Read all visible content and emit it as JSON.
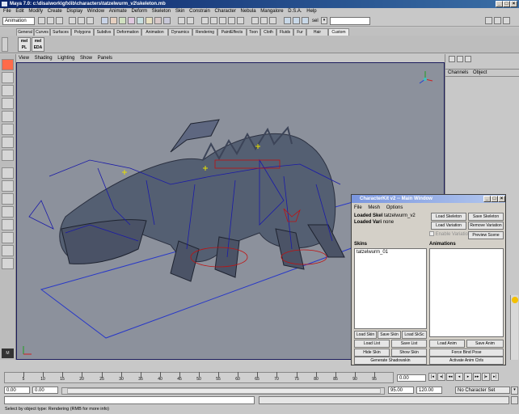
{
  "title": "Maya 7.0: c:\\disa\\work\\gfxlib\\characters\\tatzelwurm_v2\\skeleton.mb",
  "menus": [
    "File",
    "Edit",
    "Modify",
    "Create",
    "Display",
    "Window",
    "Animate",
    "Deform",
    "Skeleton",
    "Skin",
    "Constrain",
    "Character",
    "Nebula",
    "Mangalore",
    "D.S.A.",
    "Help"
  ],
  "status": {
    "mode": "Animation",
    "sel_label": "sel"
  },
  "shelf_tabs": [
    "General",
    "Curves",
    "Surfaces",
    "Polygons",
    "Subdivs",
    "Deformation",
    "Animation",
    "Dynamics",
    "Rendering",
    "PaintEffects",
    "Toon",
    "Cloth",
    "Fluids",
    "Fur",
    "Hair",
    "Custom"
  ],
  "shelf_buttons": [
    {
      "line1": "mel",
      "line2": "PL"
    },
    {
      "line1": "mel",
      "line2": "EDA"
    }
  ],
  "view_menu": [
    "View",
    "Shading",
    "Lighting",
    "Show",
    "Panels"
  ],
  "channel_box": {
    "tab1": "Channels",
    "tab2": "Object"
  },
  "timeline": {
    "ticks": [
      "5",
      "10",
      "15",
      "20",
      "25",
      "30",
      "35",
      "40",
      "45",
      "50",
      "55",
      "60",
      "65",
      "70",
      "75",
      "80",
      "85",
      "90",
      "95"
    ],
    "current": "0.00"
  },
  "range": {
    "start": "0.00",
    "start2": "0.00",
    "end": "95.00",
    "end2": "120.00",
    "character": "No Character Set"
  },
  "help": "Select by object type: Rendering (RMB for more info)",
  "ckwin": {
    "title": "CharacterKit v2 -- Main Window",
    "menus": [
      "File",
      "Mesh",
      "Options"
    ],
    "loaded_skel_label": "Loaded Skel",
    "loaded_skel_value": "tatzelwurm_v2",
    "loaded_var_label": "Loaded Vari",
    "loaded_var_value": "none",
    "btn_load_skeleton": "Load Skeleton",
    "btn_save_skeleton": "Save Skeleton",
    "btn_load_variation": "Load Variation",
    "btn_remove_variation": "Remove Variation",
    "chk_enable": "Enable Variation",
    "btn_preview_scene": "Preview Scene",
    "skins_label": "Skins",
    "skins_items": [
      "tatzelwurm_01"
    ],
    "animations_label": "Animations",
    "btn_load_skin": "Load Skin",
    "btn_save_skin": "Save Skin",
    "btn_load_skskin": "Load SkSc",
    "btn_load_list": "Load List",
    "btn_save_list": "Save List",
    "btn_hide_skin": "Hide Skin",
    "btn_show_skin": "Show Skin",
    "btn_gen_shadow": "Generate Shadowskin",
    "btn_load_anim": "Load Anim",
    "btn_save_anim": "Save Anim",
    "btn_force_bind": "Force Bind Pose",
    "btn_activate_anim": "Activate Anim Ctrls"
  }
}
